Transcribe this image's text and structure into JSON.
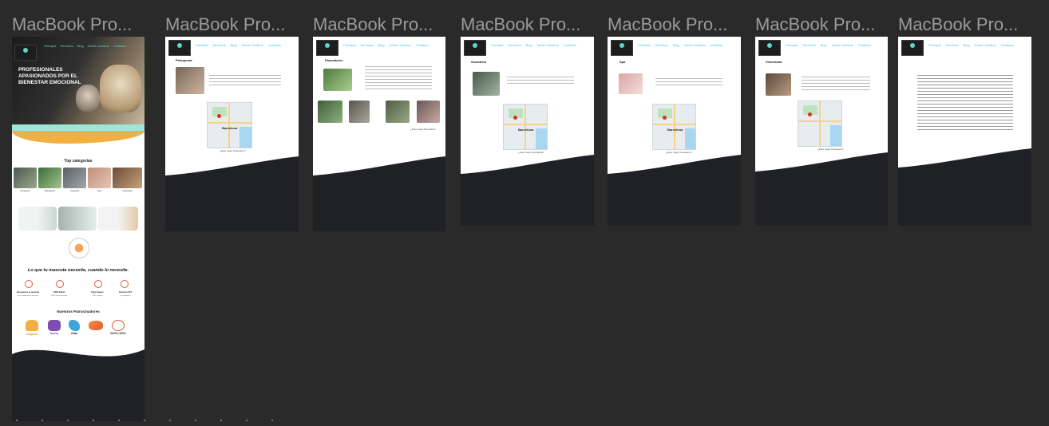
{
  "frames": [
    {
      "label": "MacBook Pro..."
    },
    {
      "label": "MacBook Pro..."
    },
    {
      "label": "MacBook Pro..."
    },
    {
      "label": "MacBook Pro..."
    },
    {
      "label": "MacBook Pro..."
    },
    {
      "label": "MacBook Pro..."
    },
    {
      "label": "MacBook Pro..."
    }
  ],
  "home": {
    "nav": [
      "Principal",
      "Servicios",
      "Blog",
      "Sobre nosotros",
      "Contacto"
    ],
    "hero_title": "PROFESIONALES APASIONADOS POR EL BIENESTAR EMOCIONAL",
    "categories_title": "Top categorias",
    "categories": [
      "Peluquería",
      "Paseadores",
      "Guardería",
      "Spa",
      "Veterinaria"
    ],
    "tagline": "Lo que tu mascota necesite, cuando lo necesite.",
    "features": [
      {
        "title": "Recogemos tu mascota",
        "text": "en la ciudad de tu mascota"
      },
      {
        "title": "100% Fiable",
        "text": "100% de tu mascota"
      },
      {
        "title": "Pago Seguro",
        "text": "100% seguro"
      },
      {
        "title": "Atención 24/7",
        "text": "Te ayudamos"
      }
    ],
    "sponsors_title": "Nuestros Patrocinadores",
    "sponsors": [
      "DogCat",
      "Husky",
      "Gato",
      "",
      "DOG LOGO"
    ]
  },
  "pages": [
    {
      "heading": "Peluquería",
      "map_city": "Barcelona",
      "map_link": "¿Eres mejor Peluquero?"
    },
    {
      "heading": "Paseadores",
      "map_city": "",
      "map_link": "¿Eres mejor Paseador?"
    },
    {
      "heading": "Guardería",
      "map_city": "Barcelona",
      "map_link": "¿Eres mejor Guardería?"
    },
    {
      "heading": "Spa",
      "map_city": "Barcelona",
      "map_link": "¿Eres mejor Peluquero?"
    },
    {
      "heading": "Veterinaria",
      "map_city": "",
      "map_link": "¿Eres mejor Peluquero?"
    }
  ],
  "colors": {
    "canvas": "#2a2a2a",
    "footer": "#202124",
    "accent": "#58b9e6",
    "teal": "#5fd6c2",
    "orange": "#f2b043"
  }
}
